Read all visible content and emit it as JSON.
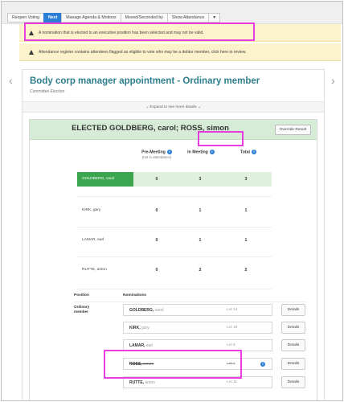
{
  "toolbar": {
    "tabs": [
      {
        "label": "Reopen Voting"
      },
      {
        "label": "Next"
      },
      {
        "label": "Manage Agenda & Motions"
      },
      {
        "label": "Moved/Seconded by"
      },
      {
        "label": "Show Attendance"
      },
      {
        "label": "▼"
      }
    ]
  },
  "banners": {
    "warning_1": "A nomination that is elected to an executive position has been selected and may not be valid.",
    "warning_2": "Attendance register contains attendees flagged as eligible to vote who may be a debtor member, click here to review."
  },
  "nav": {
    "prev": "‹",
    "next": "›"
  },
  "motion": {
    "title": "Body corp manager appointment - Ordinary member",
    "subtitle": "Committee Election",
    "expand": "⌄  Expand to see more details  ⌄"
  },
  "result": {
    "text_prefix": "ELECTED GOLDBERG, carol; ",
    "text_highlight": "ROSS, simon",
    "override": "Override Result"
  },
  "votes": {
    "headers": {
      "pre_meeting": "Pre-Meeting",
      "pre_meeting_sub": "(not in attendance)",
      "in_meeting": "In Meeting",
      "total": "Total",
      "info": "i"
    },
    "rows": [
      {
        "candidate": "GOLDBERG, carol",
        "pre": "0",
        "in": "3",
        "total": "3"
      },
      {
        "candidate": "KIRK, gary",
        "pre": "0",
        "in": "1",
        "total": "1"
      },
      {
        "candidate": "LAMAR, earl",
        "pre": "0",
        "in": "1",
        "total": "1"
      },
      {
        "candidate": "RUTTE, anton",
        "pre": "0",
        "in": "2",
        "total": "2"
      }
    ]
  },
  "nominations": {
    "headers": {
      "position": "Position",
      "nominations": "Nominations"
    },
    "position": "Ordinary member",
    "details_label": "Details",
    "rows": [
      {
        "surname": "GOLDBERG,",
        "given": "carol",
        "lot": "Lot 14"
      },
      {
        "surname": "KIRK,",
        "given": "gary",
        "lot": "Lot 19"
      },
      {
        "surname": "LAMAR,",
        "given": "earl",
        "lot": "Lot 6"
      },
      {
        "surname": "ROSS,",
        "given": "simon",
        "lot": "Lot 1"
      },
      {
        "surname": "RUTTE,",
        "given": "anton",
        "lot": "Lot 11"
      }
    ]
  },
  "colors": {
    "accent": "#2a7fd4",
    "title": "#2e7e8e",
    "elected_green": "#3ba550",
    "result_bg": "#d6ecd6",
    "banner_bg": "#fcf3cc",
    "highlight": "#e83ee0"
  }
}
